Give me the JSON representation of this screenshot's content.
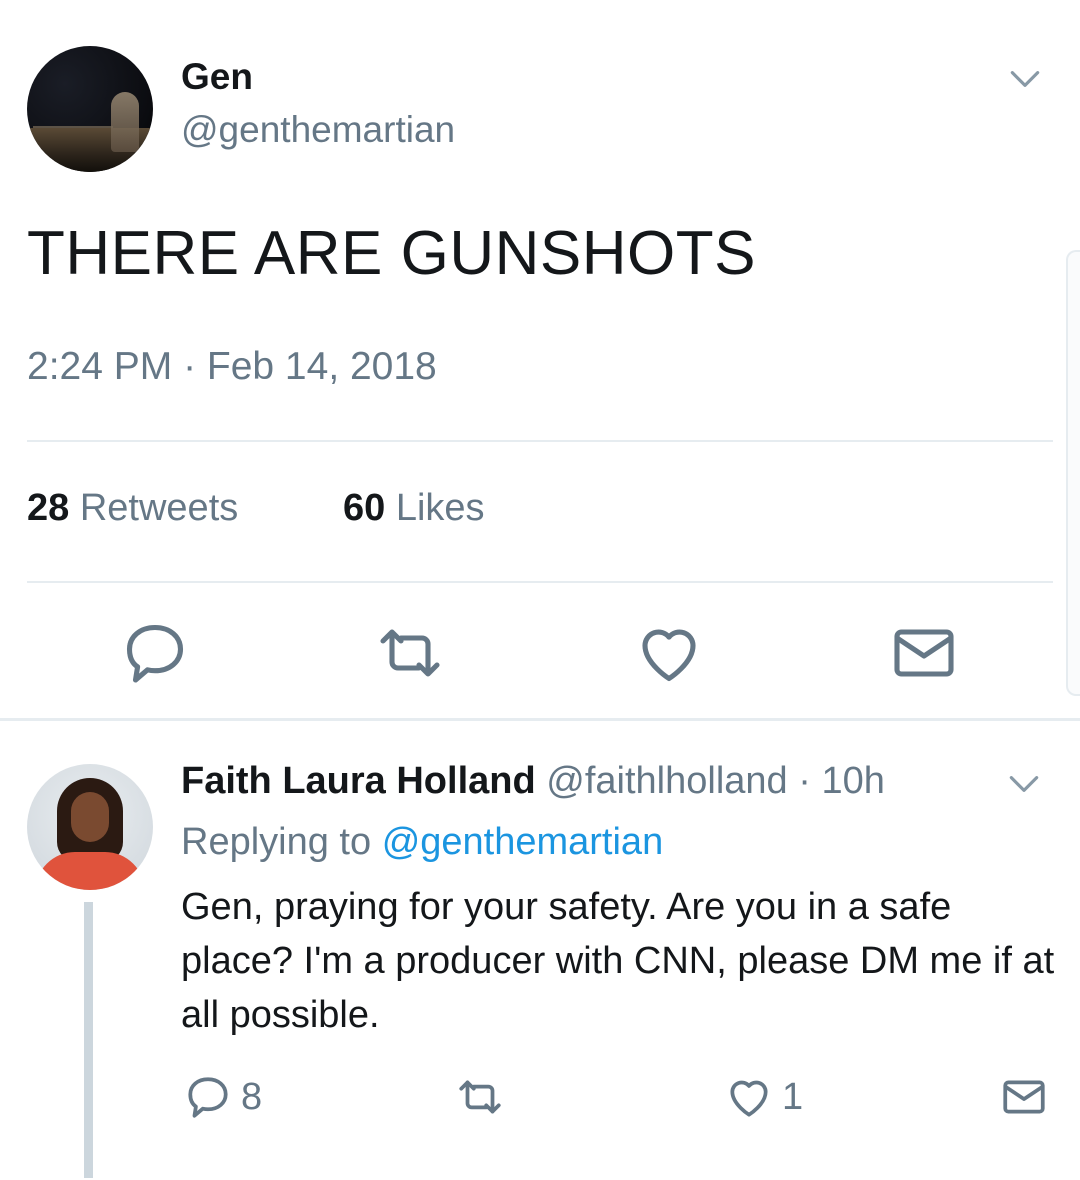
{
  "main_tweet": {
    "author_name": "Gen",
    "author_handle": "@genthemartian",
    "text": "THERE ARE GUNSHOTS",
    "timestamp": "2:24 PM · Feb 14, 2018",
    "retweets_count": "28",
    "retweets_label": "Retweets",
    "likes_count": "60",
    "likes_label": "Likes",
    "icons": [
      "reply-icon",
      "retweet-icon",
      "like-icon",
      "dm-icon"
    ]
  },
  "reply": {
    "author_name": "Faith Laura Holland",
    "author_handle": "@faithlholland",
    "separator": "·",
    "time": "10h",
    "replying_prefix": "Replying to",
    "replying_to": "@genthemartian",
    "text": "Gen, praying for your safety. Are you in a safe place? I'm a producer with CNN, please DM me if at all possible.",
    "reply_count": "8",
    "like_count": "1"
  },
  "colors": {
    "text": "#14171a",
    "secondary": "#657786",
    "link": "#1b95e0",
    "divider": "#e6ecf0"
  }
}
